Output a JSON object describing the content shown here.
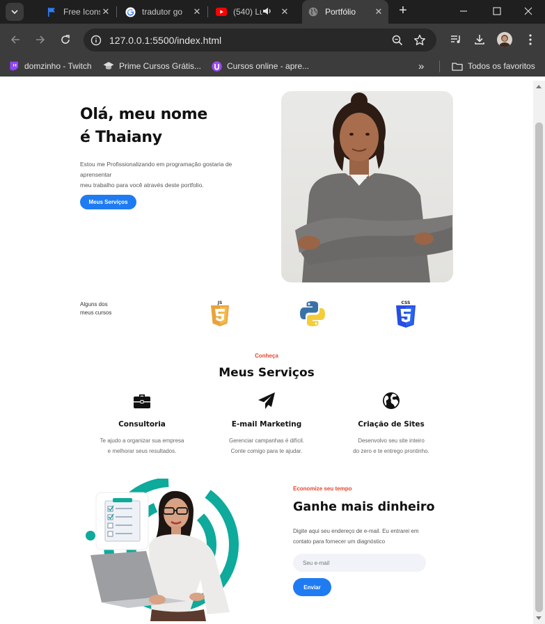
{
  "browser": {
    "tabs": [
      {
        "title": "Free Icons |",
        "active": false
      },
      {
        "title": "tradutor go",
        "active": false
      },
      {
        "title": "(540) Lu",
        "active": false
      },
      {
        "title": "Portfólio",
        "active": true
      }
    ],
    "url": "127.0.0.1:5500/index.html",
    "bookmarks": [
      {
        "label": "domzinho - Twitch"
      },
      {
        "label": "Prime Cursos Grátis..."
      },
      {
        "label": "Cursos online - apre..."
      }
    ],
    "all_bookmarks_label": "Todos os favoritos"
  },
  "hero": {
    "title_line1": "Olá, meu nome",
    "title_line2": "é Thaiany",
    "text_line1": "Estou me Profissionalizando em programação gostaria de",
    "text_line2": "aprensentar",
    "text_line3": "meu trabalho para você através deste portfolio.",
    "button_label": "Meus Serviços"
  },
  "courses": {
    "label_line1": "Alguns dos",
    "label_line2": "meus cursos",
    "items": [
      {
        "name": "JS",
        "color": "#f2a541"
      },
      {
        "name": "Python",
        "color": "#3776ab"
      },
      {
        "name": "CSS",
        "color": "#264de4"
      }
    ]
  },
  "services": {
    "eyebrow": "Conheça",
    "title": "Meus Serviços",
    "items": [
      {
        "icon": "briefcase-icon",
        "title": "Consultoria",
        "line1": "Te ajudo a organizar sua empresa",
        "line2": "e melhorar seus resultados."
      },
      {
        "icon": "paper-plane-icon",
        "title": "E-mail Marketing",
        "line1": "Gerenciar campanhas é difícil.",
        "line2": "Conte comigo para te ajudar."
      },
      {
        "icon": "globe-icon",
        "title": "Criação de Sites",
        "line1": "Desenvolvo seu site inteiro",
        "line2": "do zero e te entrego prontinho."
      }
    ]
  },
  "promo": {
    "eyebrow": "Economize seu tempo",
    "title": "Ganhe mais dinheiro",
    "text_line1": "Digite aqui seu endereço de e-mail. Eu entrarei em",
    "text_line2": "contato para fornecer um diagnóstico",
    "email_placeholder": "Seu e-mail",
    "button_label": "Enviar"
  },
  "colors": {
    "accent_blue": "#1f7bf2",
    "accent_red": "#e8442b",
    "teal": "#0eaa9c"
  }
}
